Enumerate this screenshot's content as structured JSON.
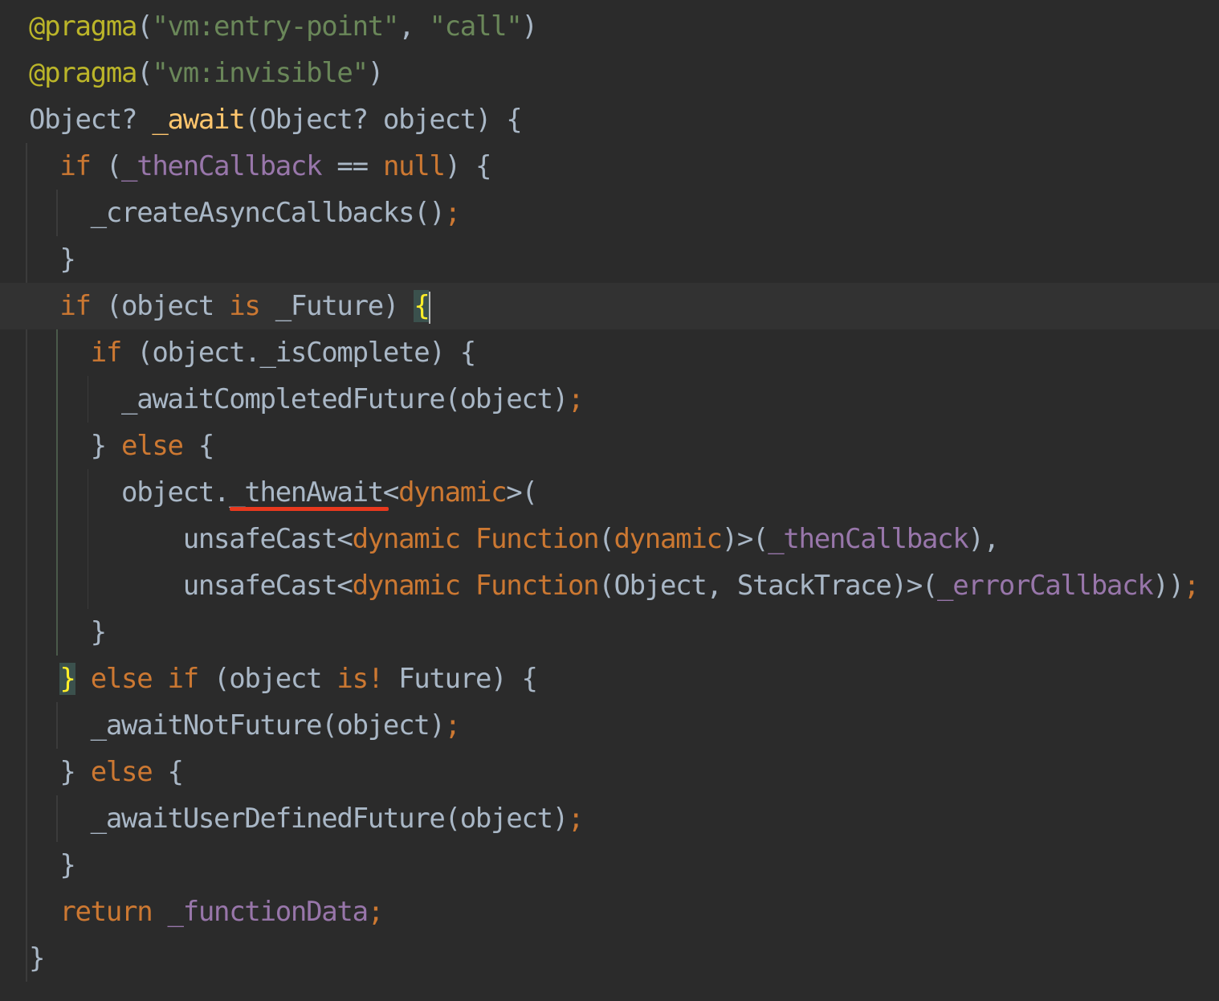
{
  "editor": {
    "background": "#2b2b2b",
    "current_line_background": "#323232",
    "annotation_mark_color": "#e8391e",
    "lines": [
      [
        {
          "t": "@pragma",
          "c": "ann"
        },
        {
          "t": "(",
          "c": "pl"
        },
        {
          "t": "\"vm:entry-point\"",
          "c": "str"
        },
        {
          "t": ", ",
          "c": "pl"
        },
        {
          "t": "\"call\"",
          "c": "str"
        },
        {
          "t": ")",
          "c": "pl"
        }
      ],
      [
        {
          "t": "@pragma",
          "c": "ann"
        },
        {
          "t": "(",
          "c": "pl"
        },
        {
          "t": "\"vm:invisible\"",
          "c": "str"
        },
        {
          "t": ")",
          "c": "pl"
        }
      ],
      [
        {
          "t": "Object? ",
          "c": "pl"
        },
        {
          "t": "_await",
          "c": "fn"
        },
        {
          "t": "(Object? object) {",
          "c": "pl"
        }
      ],
      [
        {
          "t": "  ",
          "c": "pl"
        },
        {
          "t": "if",
          "c": "kw"
        },
        {
          "t": " (",
          "c": "pl"
        },
        {
          "t": "_thenCallback",
          "c": "fld"
        },
        {
          "t": " == ",
          "c": "pl"
        },
        {
          "t": "null",
          "c": "kw"
        },
        {
          "t": ") {",
          "c": "pl"
        }
      ],
      [
        {
          "t": "    _createAsyncCallbacks()",
          "c": "pl"
        },
        {
          "t": ";",
          "c": "kw"
        }
      ],
      [
        {
          "t": "  }",
          "c": "pl"
        }
      ],
      [
        {
          "t": "  ",
          "c": "pl"
        },
        {
          "t": "if",
          "c": "kw"
        },
        {
          "t": " (object ",
          "c": "pl"
        },
        {
          "t": "is",
          "c": "kw"
        },
        {
          "t": " _Future) ",
          "c": "pl"
        },
        {
          "t": "{",
          "c": "brace-match"
        }
      ],
      [
        {
          "t": "    ",
          "c": "pl"
        },
        {
          "t": "if",
          "c": "kw"
        },
        {
          "t": " (object._isComplete) {",
          "c": "pl"
        }
      ],
      [
        {
          "t": "      _awaitCompletedFuture(object)",
          "c": "pl"
        },
        {
          "t": ";",
          "c": "kw"
        }
      ],
      [
        {
          "t": "    } ",
          "c": "pl"
        },
        {
          "t": "else",
          "c": "kw"
        },
        {
          "t": " {",
          "c": "pl"
        }
      ],
      [
        {
          "t": "      object._thenAwait<",
          "c": "pl"
        },
        {
          "t": "dynamic",
          "c": "kw"
        },
        {
          "t": ">(",
          "c": "pl"
        }
      ],
      [
        {
          "t": "          unsafeCast<",
          "c": "pl"
        },
        {
          "t": "dynamic Function",
          "c": "kw"
        },
        {
          "t": "(",
          "c": "pl"
        },
        {
          "t": "dynamic",
          "c": "kw"
        },
        {
          "t": ")>(",
          "c": "pl"
        },
        {
          "t": "_thenCallback",
          "c": "fld"
        },
        {
          "t": "),",
          "c": "pl"
        }
      ],
      [
        {
          "t": "          unsafeCast<",
          "c": "pl"
        },
        {
          "t": "dynamic Function",
          "c": "kw"
        },
        {
          "t": "(Object, StackTrace)>(",
          "c": "pl"
        },
        {
          "t": "_errorCallback",
          "c": "fld"
        },
        {
          "t": "))",
          "c": "pl"
        },
        {
          "t": ";",
          "c": "kw"
        }
      ],
      [
        {
          "t": "    }",
          "c": "pl"
        }
      ],
      [
        {
          "t": "  ",
          "c": "pl"
        },
        {
          "t": "}",
          "c": "brace-match"
        },
        {
          "t": " ",
          "c": "pl"
        },
        {
          "t": "else if",
          "c": "kw"
        },
        {
          "t": " (object ",
          "c": "pl"
        },
        {
          "t": "is!",
          "c": "kw"
        },
        {
          "t": " Future) {",
          "c": "pl"
        }
      ],
      [
        {
          "t": "    _awaitNotFuture(object)",
          "c": "pl"
        },
        {
          "t": ";",
          "c": "kw"
        }
      ],
      [
        {
          "t": "  } ",
          "c": "pl"
        },
        {
          "t": "else",
          "c": "kw"
        },
        {
          "t": " {",
          "c": "pl"
        }
      ],
      [
        {
          "t": "    _awaitUserDefinedFuture(object)",
          "c": "pl"
        },
        {
          "t": ";",
          "c": "kw"
        }
      ],
      [
        {
          "t": "  }",
          "c": "pl"
        }
      ],
      [
        {
          "t": "  ",
          "c": "pl"
        },
        {
          "t": "return",
          "c": "kw"
        },
        {
          "t": " ",
          "c": "pl"
        },
        {
          "t": "_functionData",
          "c": "fld"
        },
        {
          "t": ";",
          "c": "kw"
        }
      ],
      [
        {
          "t": "}",
          "c": "pl"
        }
      ]
    ]
  }
}
